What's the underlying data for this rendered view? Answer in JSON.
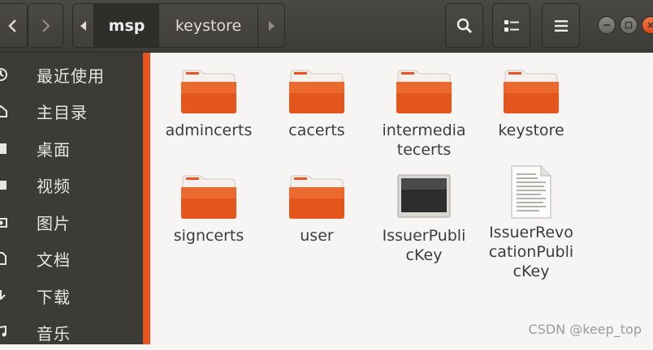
{
  "header": {
    "path_segments": [
      "msp",
      "keystore"
    ],
    "active_segment": 0
  },
  "sidebar": {
    "items": [
      {
        "label": "最近使用",
        "icon": "recent-icon"
      },
      {
        "label": "主目录",
        "icon": "home-icon"
      },
      {
        "label": "桌面",
        "icon": "desktop-icon"
      },
      {
        "label": "视频",
        "icon": "video-icon"
      },
      {
        "label": "图片",
        "icon": "camera-icon"
      },
      {
        "label": "文档",
        "icon": "document-icon"
      },
      {
        "label": "下载",
        "icon": "download-icon"
      },
      {
        "label": "音乐",
        "icon": "music-icon"
      }
    ]
  },
  "files": [
    {
      "label": "admincerts",
      "icon": "folder-icon"
    },
    {
      "label": "cacerts",
      "icon": "folder-icon"
    },
    {
      "label": "intermediatecerts",
      "icon": "folder-icon"
    },
    {
      "label": "keystore",
      "icon": "folder-icon"
    },
    {
      "label": "signcerts",
      "icon": "folder-icon"
    },
    {
      "label": "user",
      "icon": "folder-icon"
    },
    {
      "label": "IssuerPublicKey",
      "icon": "binary-file-icon"
    },
    {
      "label": "IssuerRevocationPublicKey",
      "icon": "text-file-icon"
    }
  ],
  "watermark": "CSDN @keep_top",
  "colors": {
    "accent": "#e95420",
    "headerbar": "#3c3b37",
    "sidebar": "#3c3b37",
    "content_bg": "#f6f5f4"
  }
}
